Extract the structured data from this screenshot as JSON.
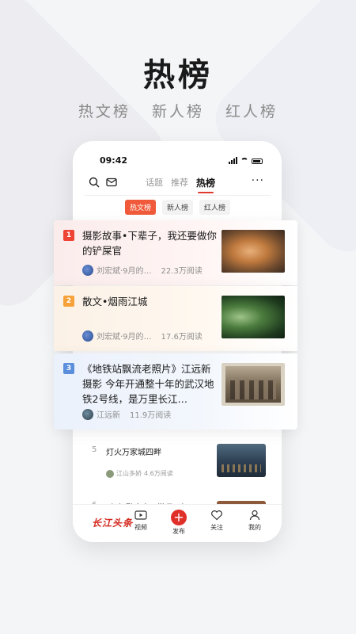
{
  "promo": {
    "title": "热榜",
    "subtitles": [
      "热文榜",
      "新人榜",
      "红人榜"
    ]
  },
  "phone": {
    "status_time": "09:42",
    "nav_tabs": [
      "话题",
      "推荐",
      "热榜"
    ],
    "active_tab": "热榜",
    "subtabs": [
      "热文榜",
      "新人榜",
      "红人榜"
    ],
    "active_subtab": "热文榜",
    "list": [
      {
        "rank": "5",
        "title": "灯火万家城四畔",
        "author": "江山多娇",
        "reads": "4.6万阅读"
      },
      {
        "rank": "6",
        "title": "“红籽融合之…游旦…智…"
      }
    ],
    "bottom_nav": {
      "logo": "长江头条",
      "items": [
        "视频",
        "发布",
        "关注",
        "我的"
      ]
    }
  },
  "cards": [
    {
      "rank": "1",
      "title": "摄影故事•下辈子，我还要做你的铲屎官",
      "author": "刘宏斌·9月的…",
      "reads": "22.3万阅读"
    },
    {
      "rank": "2",
      "title": "散文•烟雨江城",
      "author": "刘宏斌·9月的…",
      "reads": "17.6万阅读"
    },
    {
      "rank": "3",
      "title": "《地铁站飘流老照片》江远新摄影 今年开通整十年的武汉地铁2号线，是万里长江…",
      "author": "江远新",
      "reads": "11.9万阅读"
    }
  ],
  "colors": {
    "accent": "#e03a2f",
    "rank1": "#ee4433",
    "rank2": "#f6a13a",
    "rank3": "#5b8fdc"
  }
}
